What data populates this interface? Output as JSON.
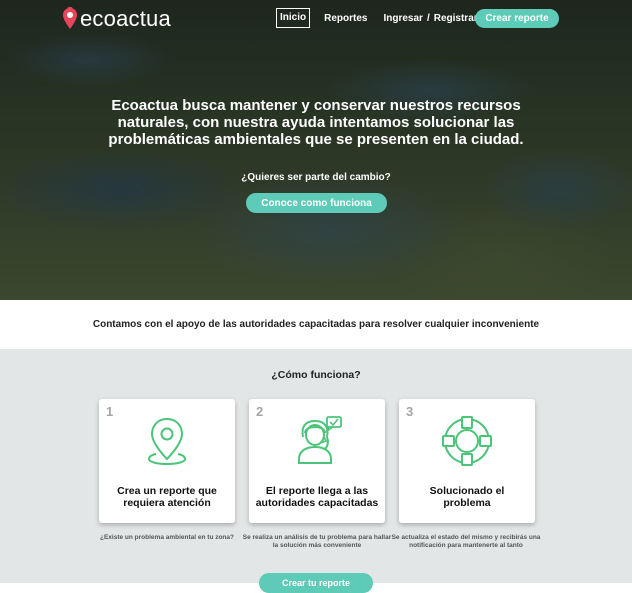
{
  "brand": {
    "name": "ecoactua",
    "logo_icon": "location-pin-logo-icon",
    "logo_color": "#e8455a"
  },
  "nav": {
    "inicio": "Inicio",
    "reportes": "Reportes",
    "ingresar": "Ingresar",
    "separator": "/",
    "registrarse": "Registrarse",
    "crear_reporte": "Crear reporte"
  },
  "hero": {
    "title": "Ecoactua busca mantener y conservar nuestros recursos naturales, con nuestra ayuda intentamos solucionar las problemáticas ambientales que se presenten en la ciudad.",
    "subtitle": "¿Quieres ser parte del cambio?",
    "cta": "Conoce como funciona"
  },
  "support": {
    "text": "Contamos con el apoyo de las autoridades capacitadas para resolver cualquier inconveniente"
  },
  "how": {
    "title": "¿Cómo funciona?",
    "steps": [
      {
        "number": "1",
        "icon": "location-pin-icon",
        "title": "Crea un reporte que requiera atención",
        "caption": "¿Existe un problema ambiental en tu zona?"
      },
      {
        "number": "2",
        "icon": "support-agent-icon",
        "title": "El reporte llega a las autoridades capacitadas",
        "caption": "Se realiza un análisis de tu problema para hallar la solución más conveniente"
      },
      {
        "number": "3",
        "icon": "lifebuoy-icon",
        "title": "Solucionado el problema",
        "caption": "Se actualiza el estado del mismo y recibirás una notificación para mantenerte al tanto"
      }
    ],
    "cta": "Crear tu reporte"
  },
  "colors": {
    "accent": "#5ecbb8",
    "icon_green": "#4cc47a",
    "section_bg": "#e2e6e6"
  }
}
